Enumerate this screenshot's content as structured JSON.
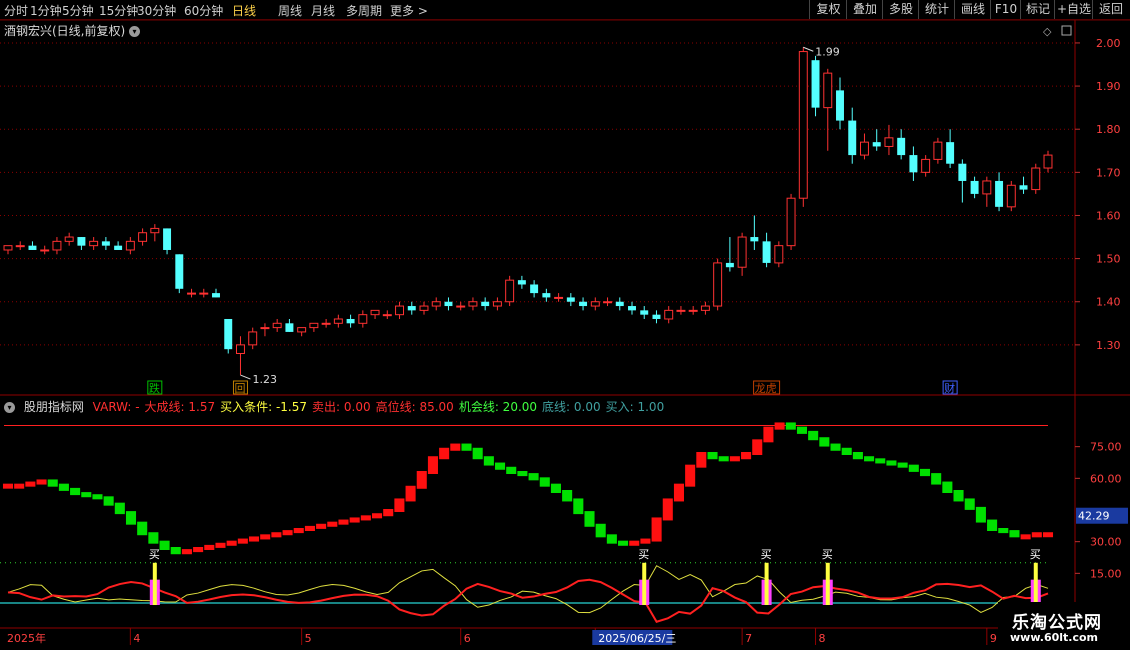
{
  "toolbar": {
    "left": [
      "分时",
      "1分钟",
      "5分钟",
      "15分钟",
      "30分钟",
      "60分钟",
      "日线",
      "周线",
      "月线",
      "多周期",
      "更多 >"
    ],
    "active_index": 6,
    "right": [
      "复权",
      "叠加",
      "多股",
      "统计",
      "画线",
      "F10",
      "标记",
      "+自选",
      "返回"
    ]
  },
  "stock_title": "酒钢宏兴(日线,前复权)",
  "price_axis": [
    "2.00",
    "1.90",
    "1.80",
    "1.70",
    "1.60",
    "1.50",
    "1.40",
    "1.30"
  ],
  "price_range": [
    1.2,
    2.03
  ],
  "annot_high": "1.99",
  "annot_low": "1.23",
  "events": [
    {
      "label": "跌",
      "bar": 12,
      "color": "#00c000"
    },
    {
      "label": "回",
      "bar": 19,
      "color": "#c08000"
    },
    {
      "label": "龙虎",
      "bar": 62,
      "color": "#c04000"
    },
    {
      "label": "财",
      "bar": 77,
      "color": "#4060ff"
    }
  ],
  "indicator": {
    "name": "股朋指标网",
    "params": [
      {
        "text": "VARW: -",
        "color": "#ff3030"
      },
      {
        "text": "大成线: 1.57",
        "color": "#ff3030"
      },
      {
        "text": "买入条件: -1.57",
        "color": "#ffff40"
      },
      {
        "text": "卖出: 0.00",
        "color": "#ff3030"
      },
      {
        "text": "高位线: 85.00",
        "color": "#ff3030"
      },
      {
        "text": "机会线: 20.00",
        "color": "#40ff40"
      },
      {
        "text": "底线: 0.00",
        "color": "#40a0a0"
      },
      {
        "text": "买入: 1.00",
        "color": "#40a0a0"
      }
    ],
    "axis": [
      "75.00",
      "60.00",
      "30.00",
      "15.00"
    ],
    "current_value": "42.29",
    "buy_label": "买"
  },
  "date_axis": [
    {
      "label": "2025年",
      "bar": 0
    },
    {
      "label": "4",
      "bar": 10
    },
    {
      "label": "5",
      "bar": 24
    },
    {
      "label": "6",
      "bar": 37
    },
    {
      "label": "2025/06/25/三",
      "bar": 48,
      "highlight": true
    },
    {
      "label": "7",
      "bar": 60
    },
    {
      "label": "8",
      "bar": 66
    },
    {
      "label": "9",
      "bar": 80
    }
  ],
  "watermark": {
    "cn": "乐淘公式网",
    "url": "www.60lt.com"
  },
  "colors": {
    "up": "#ff3232",
    "down": "#54ffff",
    "green": "#00e000",
    "red": "#ff1010",
    "yellow": "#ffff40",
    "magenta": "#ff40ff",
    "cyan": "#20b0b0",
    "grid": "#8a0000"
  },
  "chart_data": {
    "type": "candlestick",
    "candles": [
      [
        1.52,
        1.53,
        1.51,
        1.53
      ],
      [
        1.53,
        1.54,
        1.52,
        1.53
      ],
      [
        1.53,
        1.54,
        1.52,
        1.52
      ],
      [
        1.52,
        1.53,
        1.51,
        1.52
      ],
      [
        1.52,
        1.55,
        1.51,
        1.54
      ],
      [
        1.54,
        1.56,
        1.53,
        1.55
      ],
      [
        1.55,
        1.55,
        1.52,
        1.53
      ],
      [
        1.53,
        1.55,
        1.52,
        1.54
      ],
      [
        1.54,
        1.55,
        1.52,
        1.53
      ],
      [
        1.53,
        1.54,
        1.52,
        1.52
      ],
      [
        1.52,
        1.55,
        1.51,
        1.54
      ],
      [
        1.54,
        1.57,
        1.53,
        1.56
      ],
      [
        1.56,
        1.58,
        1.54,
        1.57
      ],
      [
        1.57,
        1.57,
        1.51,
        1.52
      ],
      [
        1.51,
        1.51,
        1.42,
        1.43
      ],
      [
        1.42,
        1.43,
        1.41,
        1.42
      ],
      [
        1.42,
        1.43,
        1.41,
        1.42
      ],
      [
        1.42,
        1.43,
        1.41,
        1.41
      ],
      [
        1.36,
        1.36,
        1.28,
        1.29
      ],
      [
        1.28,
        1.32,
        1.23,
        1.3
      ],
      [
        1.3,
        1.34,
        1.29,
        1.33
      ],
      [
        1.34,
        1.35,
        1.32,
        1.34
      ],
      [
        1.34,
        1.36,
        1.33,
        1.35
      ],
      [
        1.35,
        1.36,
        1.33,
        1.33
      ],
      [
        1.33,
        1.34,
        1.32,
        1.34
      ],
      [
        1.34,
        1.35,
        1.33,
        1.35
      ],
      [
        1.35,
        1.36,
        1.34,
        1.35
      ],
      [
        1.35,
        1.37,
        1.34,
        1.36
      ],
      [
        1.36,
        1.37,
        1.34,
        1.35
      ],
      [
        1.35,
        1.38,
        1.34,
        1.37
      ],
      [
        1.37,
        1.38,
        1.36,
        1.38
      ],
      [
        1.37,
        1.38,
        1.36,
        1.37
      ],
      [
        1.37,
        1.4,
        1.36,
        1.39
      ],
      [
        1.39,
        1.4,
        1.37,
        1.38
      ],
      [
        1.38,
        1.4,
        1.37,
        1.39
      ],
      [
        1.39,
        1.41,
        1.38,
        1.4
      ],
      [
        1.4,
        1.41,
        1.38,
        1.39
      ],
      [
        1.39,
        1.4,
        1.38,
        1.39
      ],
      [
        1.39,
        1.41,
        1.38,
        1.4
      ],
      [
        1.4,
        1.41,
        1.38,
        1.39
      ],
      [
        1.39,
        1.41,
        1.38,
        1.4
      ],
      [
        1.4,
        1.46,
        1.39,
        1.45
      ],
      [
        1.45,
        1.46,
        1.43,
        1.44
      ],
      [
        1.44,
        1.45,
        1.41,
        1.42
      ],
      [
        1.42,
        1.43,
        1.4,
        1.41
      ],
      [
        1.41,
        1.42,
        1.4,
        1.41
      ],
      [
        1.41,
        1.42,
        1.39,
        1.4
      ],
      [
        1.4,
        1.41,
        1.38,
        1.39
      ],
      [
        1.39,
        1.41,
        1.38,
        1.4
      ],
      [
        1.4,
        1.41,
        1.39,
        1.4
      ],
      [
        1.4,
        1.41,
        1.38,
        1.39
      ],
      [
        1.39,
        1.4,
        1.37,
        1.38
      ],
      [
        1.38,
        1.39,
        1.36,
        1.37
      ],
      [
        1.37,
        1.38,
        1.35,
        1.36
      ],
      [
        1.36,
        1.39,
        1.35,
        1.38
      ],
      [
        1.38,
        1.39,
        1.37,
        1.38
      ],
      [
        1.38,
        1.39,
        1.37,
        1.38
      ],
      [
        1.38,
        1.4,
        1.37,
        1.39
      ],
      [
        1.39,
        1.5,
        1.38,
        1.49
      ],
      [
        1.49,
        1.55,
        1.47,
        1.48
      ],
      [
        1.48,
        1.56,
        1.46,
        1.55
      ],
      [
        1.55,
        1.6,
        1.52,
        1.54
      ],
      [
        1.54,
        1.56,
        1.48,
        1.49
      ],
      [
        1.49,
        1.54,
        1.48,
        1.53
      ],
      [
        1.53,
        1.65,
        1.52,
        1.64
      ],
      [
        1.64,
        1.99,
        1.62,
        1.98
      ],
      [
        1.96,
        1.97,
        1.83,
        1.85
      ],
      [
        1.85,
        1.94,
        1.75,
        1.93
      ],
      [
        1.89,
        1.92,
        1.8,
        1.82
      ],
      [
        1.82,
        1.85,
        1.72,
        1.74
      ],
      [
        1.74,
        1.79,
        1.73,
        1.77
      ],
      [
        1.77,
        1.8,
        1.75,
        1.76
      ],
      [
        1.76,
        1.81,
        1.74,
        1.78
      ],
      [
        1.78,
        1.8,
        1.73,
        1.74
      ],
      [
        1.74,
        1.76,
        1.68,
        1.7
      ],
      [
        1.7,
        1.74,
        1.69,
        1.73
      ],
      [
        1.73,
        1.78,
        1.72,
        1.77
      ],
      [
        1.77,
        1.8,
        1.71,
        1.72
      ],
      [
        1.72,
        1.73,
        1.63,
        1.68
      ],
      [
        1.68,
        1.69,
        1.64,
        1.65
      ],
      [
        1.65,
        1.69,
        1.62,
        1.68
      ],
      [
        1.68,
        1.7,
        1.61,
        1.62
      ],
      [
        1.62,
        1.68,
        1.61,
        1.67
      ],
      [
        1.67,
        1.69,
        1.65,
        1.66
      ],
      [
        1.66,
        1.72,
        1.65,
        1.71
      ],
      [
        1.71,
        1.75,
        1.7,
        1.74
      ]
    ],
    "indicator_values": [
      57,
      57,
      58,
      59,
      57,
      55,
      53,
      52,
      51,
      48,
      44,
      39,
      34,
      30,
      27,
      25,
      26,
      27,
      28,
      29,
      30,
      31,
      32,
      33,
      34,
      35,
      36,
      37,
      38,
      39,
      40,
      41,
      42,
      43,
      45,
      50,
      56,
      63,
      70,
      74,
      76,
      74,
      70,
      67,
      65,
      63,
      62,
      60,
      57,
      54,
      50,
      44,
      38,
      33,
      30,
      29,
      30,
      31,
      41,
      50,
      57,
      66,
      72,
      70,
      69,
      70,
      72,
      78,
      84,
      86,
      84,
      82,
      79,
      76,
      74,
      72,
      70,
      69,
      68,
      67,
      66,
      64,
      62,
      58,
      54,
      50,
      46,
      40,
      36,
      35,
      33,
      33,
      34,
      34
    ],
    "buy_signal_bars": [
      12,
      52,
      62,
      67,
      84
    ],
    "indicator_range": [
      0,
      90
    ]
  }
}
